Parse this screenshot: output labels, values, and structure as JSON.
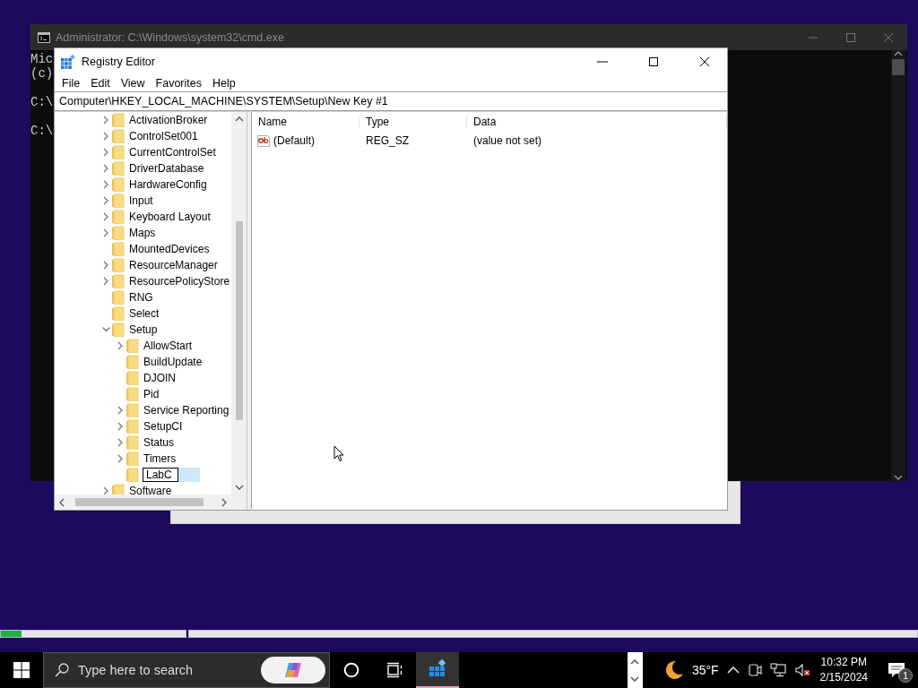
{
  "cmd_window": {
    "title": "Administrator: C:\\Windows\\system32\\cmd.exe",
    "blocks": [
      {
        "lines": [
          "Mic",
          "(c)"
        ]
      },
      {
        "lines": [
          "C:\\"
        ]
      },
      {
        "lines": [
          "C:\\"
        ]
      }
    ]
  },
  "regedit": {
    "title": "Registry Editor",
    "menu": [
      "File",
      "Edit",
      "View",
      "Favorites",
      "Help"
    ],
    "address": "Computer\\HKEY_LOCAL_MACHINE\\SYSTEM\\Setup\\New Key #1",
    "tree": [
      {
        "label": "ActivationBroker",
        "kind": "branch",
        "expanded": false,
        "selected": false
      },
      {
        "label": "ControlSet001",
        "kind": "branch",
        "expanded": false,
        "selected": false
      },
      {
        "label": "CurrentControlSet",
        "kind": "branch",
        "expanded": false,
        "selected": false
      },
      {
        "label": "DriverDatabase",
        "kind": "branch",
        "expanded": false,
        "selected": false
      },
      {
        "label": "HardwareConfig",
        "kind": "branch",
        "expanded": false,
        "selected": false
      },
      {
        "label": "Input",
        "kind": "branch",
        "expanded": false,
        "selected": false
      },
      {
        "label": "Keyboard Layout",
        "kind": "branch",
        "expanded": false,
        "selected": false
      },
      {
        "label": "Maps",
        "kind": "branch",
        "expanded": false,
        "selected": false
      },
      {
        "label": "MountedDevices",
        "kind": "leaf",
        "selected": false
      },
      {
        "label": "ResourceManager",
        "kind": "branch",
        "expanded": false,
        "selected": false
      },
      {
        "label": "ResourcePolicyStore",
        "kind": "branch",
        "expanded": false,
        "selected": false
      },
      {
        "label": "RNG",
        "kind": "leaf",
        "selected": false
      },
      {
        "label": "Select",
        "kind": "leaf",
        "selected": false
      },
      {
        "label": "Setup",
        "kind": "branch",
        "expanded": true,
        "selected": false,
        "children": [
          {
            "label": "AllowStart",
            "kind": "branch",
            "expanded": false,
            "selected": false
          },
          {
            "label": "BuildUpdate",
            "kind": "leaf",
            "selected": false
          },
          {
            "label": "DJOIN",
            "kind": "leaf",
            "selected": false
          },
          {
            "label": "Pid",
            "kind": "leaf",
            "selected": false
          },
          {
            "label": "Service Reporting",
            "kind": "branch",
            "expanded": false,
            "selected": false
          },
          {
            "label": "SetupCI",
            "kind": "branch",
            "expanded": false,
            "selected": false
          },
          {
            "label": "Status",
            "kind": "branch",
            "expanded": false,
            "selected": false
          },
          {
            "label": "Timers",
            "kind": "branch",
            "expanded": false,
            "selected": false
          },
          {
            "label": "LabC",
            "kind": "rename",
            "selected": true
          }
        ]
      },
      {
        "label": "Software",
        "kind": "branch",
        "expanded": false,
        "selected": false
      }
    ],
    "columns": [
      "Name",
      "Type",
      "Data"
    ],
    "rows": [
      {
        "name": "(Default)",
        "type": "REG_SZ",
        "data": "(value not set)"
      }
    ]
  },
  "progress_bars": [
    {
      "level": 0.11
    }
  ],
  "taskbar": {
    "search": {
      "placeholder": "Type here to search"
    },
    "buttons": [
      {
        "kind": "cortana",
        "selected": false
      },
      {
        "kind": "task-view",
        "selected": false
      },
      {
        "kind": "regedit",
        "selected": true
      }
    ],
    "weather": {
      "temperature": "35°F"
    },
    "clock": {
      "time": "10:32 PM",
      "date": "2/15/2024"
    },
    "notifications": {
      "count": "1"
    }
  }
}
